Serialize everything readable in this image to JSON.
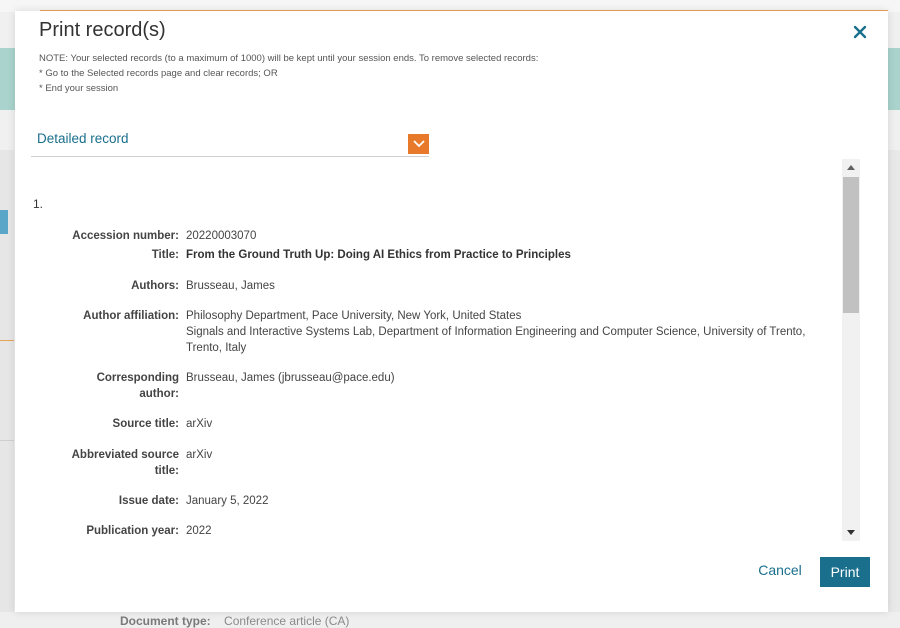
{
  "background": {
    "document_type_label": "Document type:",
    "document_type_value": "Conference article (CA)"
  },
  "dialog": {
    "title": "Print record(s)",
    "note_lines": [
      "NOTE: Your selected records (to a maximum of 1000) will be kept until your session ends. To remove selected records:",
      "* Go to the Selected records page and clear records; OR",
      "* End your session"
    ],
    "format_select": {
      "value": "Detailed record"
    },
    "record": {
      "number": "1.",
      "fields": [
        {
          "label": "Accession number:",
          "value": "20220003070"
        },
        {
          "label": "Title:",
          "value": "From the Ground Truth Up: Doing AI Ethics from Practice to Principles"
        },
        {
          "label": "Authors:",
          "value": "Brusseau, James"
        },
        {
          "label": "Author affiliation:",
          "value": "Philosophy Department, Pace University, New York, United States"
        },
        {
          "label": "",
          "value": "Signals and Interactive Systems Lab, Department of Information Engineering and Computer Science, University of Trento,"
        },
        {
          "label": "",
          "value": "Trento, Italy"
        },
        {
          "label": "Corresponding",
          "value": "Brusseau, James (jbrusseau@pace.edu)"
        },
        {
          "label": "author:",
          "value": ""
        },
        {
          "label": "Source title:",
          "value": "arXiv"
        },
        {
          "label": "Abbreviated source",
          "value": "arXiv"
        },
        {
          "label": "title:",
          "value": ""
        },
        {
          "label": "Issue date:",
          "value": "January 5, 2022"
        },
        {
          "label": "Publication year:",
          "value": "2022"
        }
      ]
    },
    "buttons": {
      "cancel": "Cancel",
      "print": "Print"
    }
  },
  "colors": {
    "accent_teal": "#1a6f8c",
    "accent_orange": "#e8782a"
  },
  "icons": {
    "close": "close-icon",
    "dropdown": "chevron-down-icon",
    "scroll_up": "scroll-up-arrow-icon",
    "scroll_down": "scroll-down-arrow-icon"
  }
}
